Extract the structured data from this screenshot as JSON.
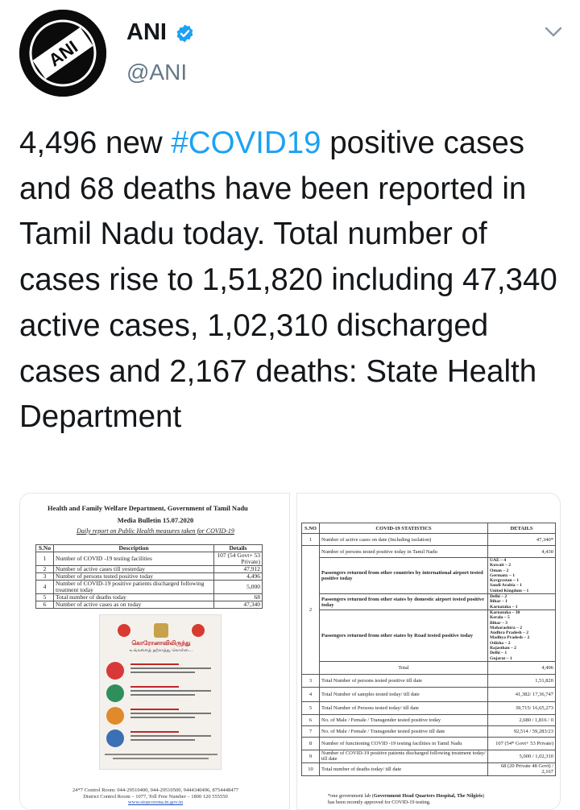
{
  "header": {
    "display_name": "ANI",
    "handle": "@ANI",
    "avatar_text": "ANI",
    "verified_icon": "verified-badge-icon",
    "menu_icon": "chevron-down-icon",
    "colors": {
      "verified": "#1da1f2",
      "hashtag": "#1da1f2",
      "handle": "#657786",
      "text": "#14171a"
    }
  },
  "tweet": {
    "text_before": "4,496 new ",
    "hashtag": "#COVID19",
    "text_after": " positive cases and 68 deaths have been reported in Tamil Nadu today. Total number of cases rise to 1,51,820 including 47,340 active cases, 1,02,310 discharged cases and 2,167 deaths: State Health Department"
  },
  "bulletin_left": {
    "title": "Health and Family Welfare Department, Government of Tamil Nadu",
    "media_bulletin": "Media Bulletin 15.07.2020",
    "daily_report": "Daily report on Public Health measures taken for COVID-19",
    "columns": [
      "S.No",
      "Description",
      "Details"
    ],
    "rows": [
      {
        "sno": "1",
        "desc": "Number of COVID -19 testing facilities",
        "det": "107 (54 Govt+ 53 Private)"
      },
      {
        "sno": "2",
        "desc": "Number of active cases till yesterday",
        "det": "47,912"
      },
      {
        "sno": "3",
        "desc": "Number of persons tested positive today",
        "det": "4,496"
      },
      {
        "sno": "4",
        "desc": "Number of COVID-19 positive patients discharged following treatment today",
        "det": "5,000"
      },
      {
        "sno": "5",
        "desc": "Total number of deaths today",
        "det": "68"
      },
      {
        "sno": "6",
        "desc": "Number of active cases as on today",
        "det": "47,340"
      }
    ],
    "poster_title": "கொரோனாவிலிருந்து",
    "poster_subtitle": "உங்களைத் தற்காத்து கொள்ள...",
    "contact_line1": "24*7 Control Room: 044-29510400, 044-29510500, 9444340496, 8754448477",
    "contact_line2": "District Control Room – 1077, Toll Free Number – 1800 120 555550",
    "website": "www.stopcorona.tn.gov.in"
  },
  "bulletin_right": {
    "columns": [
      "S.NO",
      "COVID-19 STATISTICS",
      "DETAILS"
    ],
    "row1": {
      "sno": "1",
      "desc": "Number of active cases on date (Including isolation)",
      "det": "47,340*"
    },
    "row2_tested": {
      "desc": "Number of persons tested positive today in Tamil Nadu",
      "det": "4,430"
    },
    "row2_sno": "2",
    "row2_airport": {
      "desc": "Passengers returned from other countries by international airport tested positive today",
      "items": [
        "UAE – 4",
        "Kuwait – 2",
        "Oman – 2",
        "Germany – 1",
        "Kyrgyzstan – 1",
        "Saudi Arabia – 1",
        "United Kingdom – 1"
      ]
    },
    "row2_domestic": {
      "desc": "Passengers returned from other states by domestic airport tested positive today",
      "items": [
        "Delhi – 2",
        "Bihar – 1",
        "Karnataka – 1"
      ]
    },
    "row2_road": {
      "desc": "Passengers returned from other states by Road tested positive today",
      "items": [
        "Karnataka – 30",
        "Kerala – 5",
        "Bihar – 3",
        "Maharashtra – 2",
        "Andhra Pradesh – 2",
        "Madhya Pradesh – 2",
        "Odisha – 2",
        "Rajasthan – 2",
        "Delhi – 1",
        "Gujarat – 1"
      ]
    },
    "row2_total": {
      "label": "Total",
      "det": "4,496"
    },
    "rows": [
      {
        "sno": "3",
        "desc": "Total Number of persons tested positive till date",
        "det": "1,51,820"
      },
      {
        "sno": "4",
        "desc": "Total Number of samples tested today/ till date",
        "det": "41,382/ 17,36,747"
      },
      {
        "sno": "5",
        "desc": "Total Number of Persons tested today/ till date",
        "det": "39,715/ 16,65,273"
      },
      {
        "sno": "6",
        "desc": "No. of Male / Female / Transgender tested positive today",
        "det": "2,680 / 1,816 / 0"
      },
      {
        "sno": "7",
        "desc": "No. of Male / Female / Transgender tested positive till date",
        "det": "92,514 / 59,283/23"
      },
      {
        "sno": "8",
        "desc": "Number of functioning COVID -19 testing facilities in Tamil Nadu",
        "det": "107 (54* Govt+ 53 Private)"
      },
      {
        "sno": "9",
        "desc": "Number of COVID-19 positive patients discharged following treatment today/ till date",
        "det": "5,000 / 1,02,310"
      },
      {
        "sno": "10",
        "desc": "Total number of deaths today/ till date",
        "det": "68 (20 Private 48 Govt) / 2,167"
      }
    ],
    "note_line1_prefix": "*one government lab (",
    "note_line1_bold": "Government Head Quarters Hospital, The Nilgiris",
    "note_line1_suffix": ")",
    "note_line2": "has been recently approved for COVID-19 testing."
  }
}
